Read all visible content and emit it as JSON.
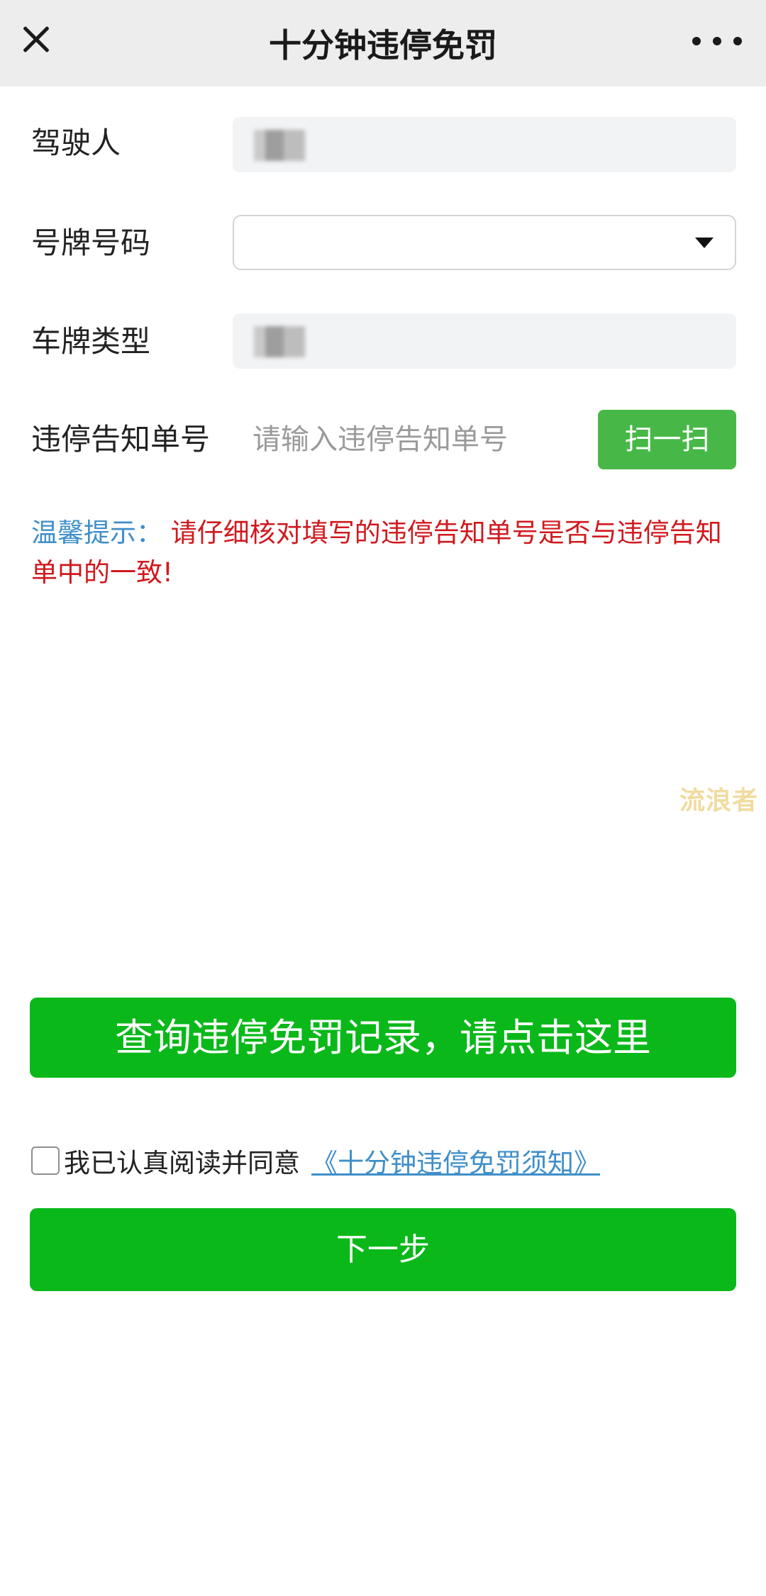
{
  "header": {
    "title": "十分钟违停免罚",
    "close_icon": "close-icon",
    "more_icon": "more-dots-icon"
  },
  "form": {
    "driver_label": "驾驶人",
    "plate_number_label": "号牌号码",
    "plate_type_label": "车牌类型",
    "ticket_label": "违停告知单号",
    "ticket_placeholder": "请输入违停告知单号",
    "ticket_value": "",
    "scan_label": "扫一扫"
  },
  "tip": {
    "label": "温馨提示：",
    "text": "请仔细核对填写的违停告知单号是否与违停告知单中的一致!"
  },
  "watermark": "流浪者",
  "query_button": "查询违停免罚记录，请点击这里",
  "agreement": {
    "text": "我已认真阅读并同意",
    "link": "《十分钟违停免罚须知》",
    "checked": false
  },
  "next_button": "下一步",
  "colors": {
    "primary_green": "#0ab81a",
    "scan_green": "#47b847",
    "tip_blue": "#3f8fc9",
    "tip_red": "#d0191e",
    "header_bg": "#ededed"
  }
}
